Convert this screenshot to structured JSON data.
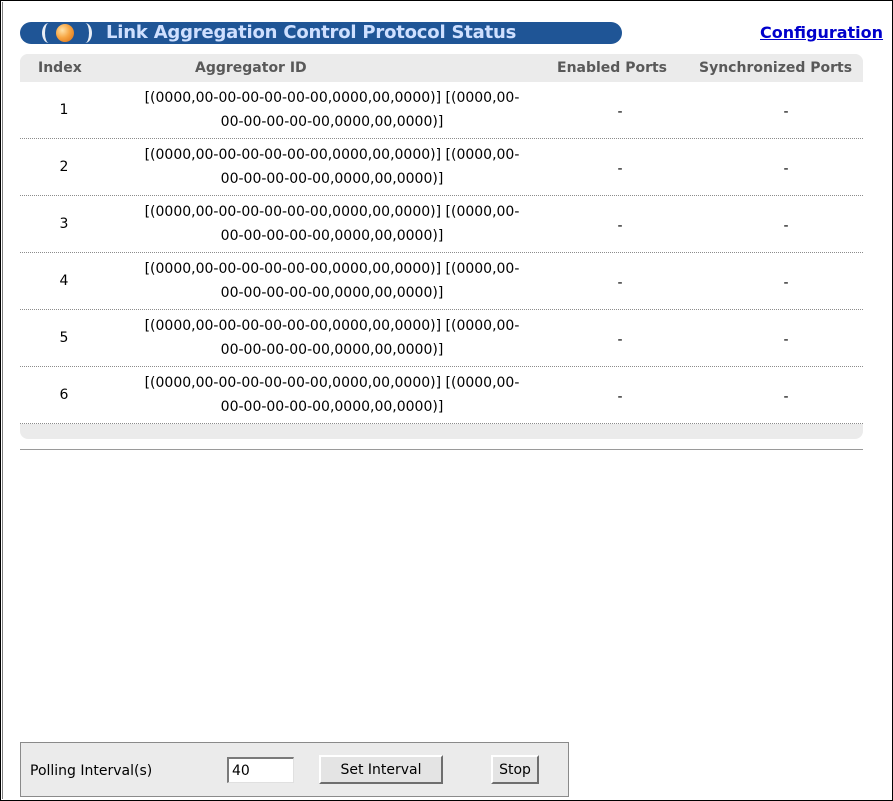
{
  "header": {
    "title": "Link Aggregation Control Protocol Status",
    "config_link": "Configuration"
  },
  "table": {
    "columns": [
      "Index",
      "Aggregator ID",
      "Enabled Ports",
      "Synchronized Ports"
    ],
    "rows": [
      {
        "index": "1",
        "agg_line1": "[(0000,00-00-00-00-00-00,0000,00,0000)] [(0000,00-",
        "agg_line2": "00-00-00-00-00,0000,00,0000)]",
        "enabled": "-",
        "sync": "-"
      },
      {
        "index": "2",
        "agg_line1": "[(0000,00-00-00-00-00-00,0000,00,0000)] [(0000,00-",
        "agg_line2": "00-00-00-00-00,0000,00,0000)]",
        "enabled": "-",
        "sync": "-"
      },
      {
        "index": "3",
        "agg_line1": "[(0000,00-00-00-00-00-00,0000,00,0000)] [(0000,00-",
        "agg_line2": "00-00-00-00-00,0000,00,0000)]",
        "enabled": "-",
        "sync": "-"
      },
      {
        "index": "4",
        "agg_line1": "[(0000,00-00-00-00-00-00,0000,00,0000)] [(0000,00-",
        "agg_line2": "00-00-00-00-00,0000,00,0000)]",
        "enabled": "-",
        "sync": "-"
      },
      {
        "index": "5",
        "agg_line1": "[(0000,00-00-00-00-00-00,0000,00,0000)] [(0000,00-",
        "agg_line2": "00-00-00-00-00,0000,00,0000)]",
        "enabled": "-",
        "sync": "-"
      },
      {
        "index": "6",
        "agg_line1": "[(0000,00-00-00-00-00-00,0000,00,0000)] [(0000,00-",
        "agg_line2": "00-00-00-00-00,0000,00,0000)]",
        "enabled": "-",
        "sync": "-"
      }
    ]
  },
  "polling": {
    "label": "Polling Interval(s)",
    "value": "40",
    "set_button": "Set Interval",
    "stop_button": "Stop"
  },
  "colors": {
    "title_bar": "#1f5596",
    "title_text": "#cfe0ff",
    "link": "#0000cc",
    "panel_bg": "#ebebeb"
  },
  "icons": {
    "title_orb": "orb-icon"
  }
}
